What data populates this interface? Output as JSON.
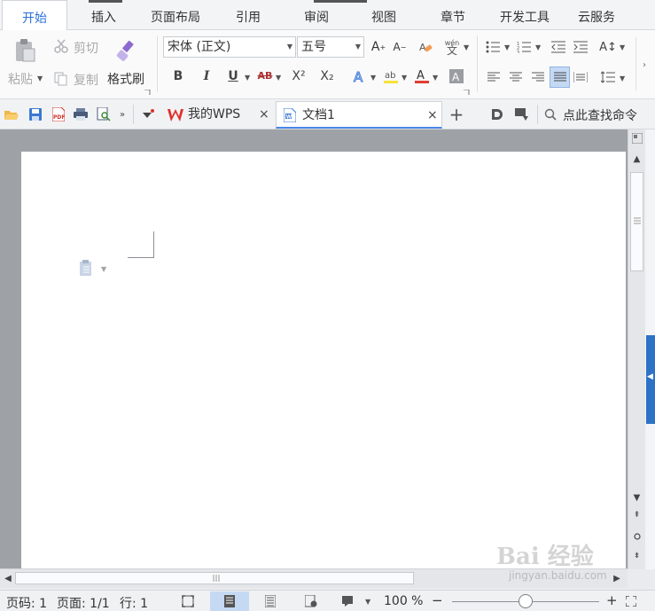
{
  "menu": {
    "tabs": [
      "开始",
      "插入",
      "页面布局",
      "引用",
      "审阅",
      "视图",
      "章节",
      "开发工具",
      "云服务"
    ]
  },
  "ribbon": {
    "paste": "粘贴",
    "cut": "剪切",
    "copy": "复制",
    "format_painter": "格式刷",
    "font_name": "宋体 (正文)",
    "font_size": "五号",
    "bold": "B",
    "italic": "I",
    "underline": "U",
    "strike": "AB",
    "superscript": "X²",
    "subscript": "X₂",
    "phonetic": "wén"
  },
  "quickbar": {
    "tabs": [
      {
        "label": "我的WPS",
        "close": "×"
      },
      {
        "label": "文档1",
        "close": "×"
      }
    ],
    "new_tab": "+",
    "search": "点此查找命令"
  },
  "statusbar": {
    "page_code": "页码: 1",
    "page": "页面: 1/1",
    "row": "行: 1",
    "zoom": "100 %",
    "zoom_fraction": 0.5,
    "zoom_minus": "−",
    "zoom_plus": "+"
  },
  "watermark": {
    "brand": "Bai 经验",
    "url": "jingyan.baidu.com"
  },
  "colors": {
    "accent": "#2a6fd6",
    "font_color": "#e03c31",
    "highlight": "#f5e23a",
    "wps_red": "#e0312b"
  }
}
